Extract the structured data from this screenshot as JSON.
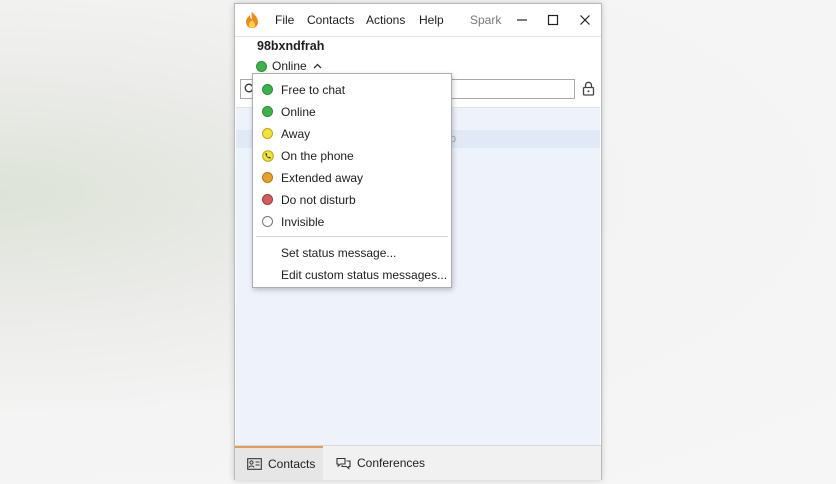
{
  "window": {
    "menu": [
      "File",
      "Contacts",
      "Actions",
      "Help"
    ],
    "brand": "Spark"
  },
  "profile": {
    "username": "98bxndfrah",
    "status": "Online"
  },
  "contact_list": {
    "faint_fragment": "p"
  },
  "status_menu": {
    "items": [
      {
        "label": "Free to chat",
        "icon": "green-status-dot-icon",
        "color": "#3cb34a"
      },
      {
        "label": "Online",
        "icon": "green-status-dot-icon",
        "color": "#3cb34a"
      },
      {
        "label": "Away",
        "icon": "yellow-status-dot-icon",
        "color": "#f3e23a"
      },
      {
        "label": "On the phone",
        "icon": "phone-status-icon",
        "color": "#f3e23a"
      },
      {
        "label": "Extended away",
        "icon": "orange-status-dot-icon",
        "color": "#eaa02e"
      },
      {
        "label": "Do not disturb",
        "icon": "red-status-dot-icon",
        "color": "#d35d5d"
      },
      {
        "label": "Invisible",
        "icon": "empty-status-circle-icon",
        "color": "#ffffff"
      }
    ],
    "actions": [
      "Set status message...",
      "Edit custom status messages..."
    ]
  },
  "tabs": [
    {
      "label": "Contacts",
      "icon": "contact-card-icon",
      "active": true
    },
    {
      "label": "Conferences",
      "icon": "chat-bubbles-icon",
      "active": false
    }
  ],
  "colors": {
    "accent": "#e59a57",
    "list_background": "#eef2fb"
  }
}
